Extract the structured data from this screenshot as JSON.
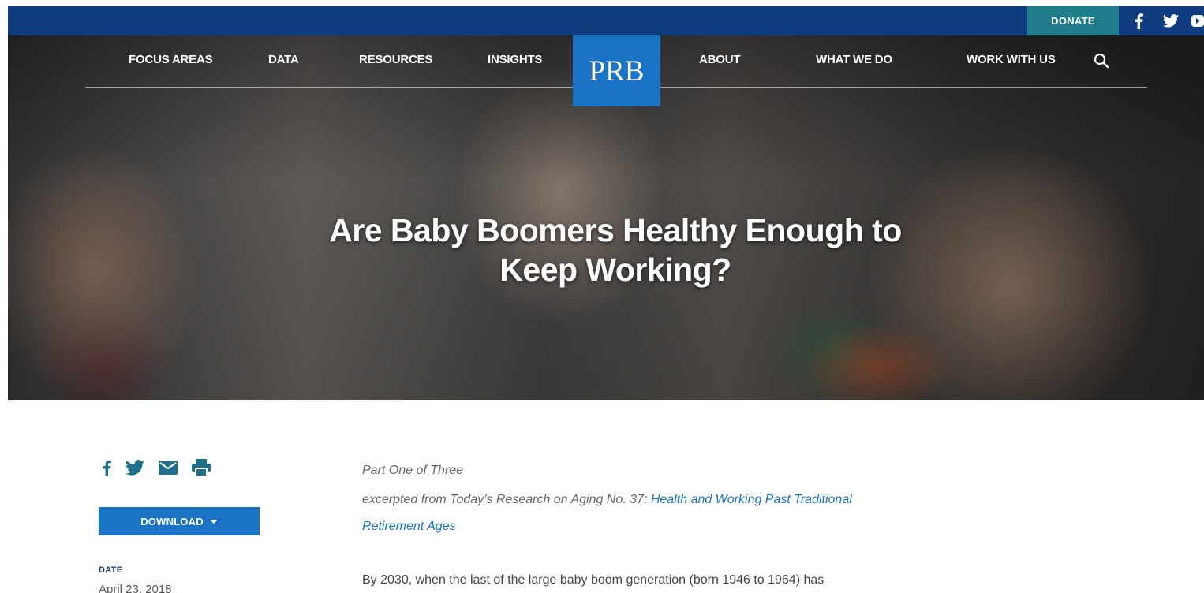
{
  "header": {
    "donate_label": "DONATE",
    "social_icons": [
      "facebook-icon",
      "twitter-icon",
      "youtube-icon"
    ]
  },
  "nav": {
    "items": [
      {
        "label": "FOCUS AREAS"
      },
      {
        "label": "DATA"
      },
      {
        "label": "RESOURCES"
      },
      {
        "label": "INSIGHTS"
      },
      {
        "label": "ABOUT"
      },
      {
        "label": "WHAT WE DO"
      },
      {
        "label": "WORK WITH US"
      }
    ],
    "logo_text": "PRB",
    "search_icon": "search-icon"
  },
  "hero": {
    "title": "Are Baby Boomers Healthy Enough to Keep Working?"
  },
  "sidebar": {
    "share_icons": [
      "facebook-icon",
      "twitter-icon",
      "email-icon",
      "print-icon"
    ],
    "download_label": "DOWNLOAD",
    "date_label": "DATE",
    "date_value": "April 23, 2018"
  },
  "article": {
    "part": "Part One of Three",
    "excerpt_prefix": "excerpted from Today’s Research on Aging No. 37: ",
    "excerpt_link": "Health and Working Past Traditional Retirement Ages",
    "body_start": "By 2030, when the last of the large baby boom generation (born 1946 to 1964) has"
  },
  "colors": {
    "top_bar": "#0f3c7f",
    "donate": "#1f7d8c",
    "brand_blue": "#1a73c4",
    "share_icon": "#1f6f8b"
  }
}
